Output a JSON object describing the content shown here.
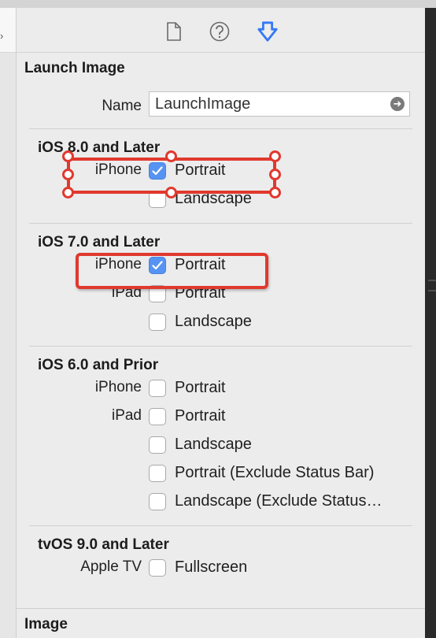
{
  "tabs": [
    {
      "icon": "file-icon"
    },
    {
      "icon": "help-icon"
    },
    {
      "icon": "attributes-icon",
      "selected": true
    }
  ],
  "accent": "#3478f6",
  "annotation_color": "#e0392e",
  "section_title": "Launch Image",
  "name_field": {
    "label": "Name",
    "value": "LaunchImage"
  },
  "groups": [
    {
      "header": "iOS 8.0 and Later",
      "rows": [
        {
          "label": "iPhone",
          "option": "Portrait",
          "checked": true
        },
        {
          "label": "",
          "option": "Landscape",
          "checked": false
        }
      ]
    },
    {
      "header": "iOS 7.0 and Later",
      "rows": [
        {
          "label": "iPhone",
          "option": "Portrait",
          "checked": true
        },
        {
          "label": "iPad",
          "option": "Portrait",
          "checked": false
        },
        {
          "label": "",
          "option": "Landscape",
          "checked": false
        }
      ]
    },
    {
      "header": "iOS 6.0 and Prior",
      "rows": [
        {
          "label": "iPhone",
          "option": "Portrait",
          "checked": false
        },
        {
          "label": "iPad",
          "option": "Portrait",
          "checked": false
        },
        {
          "label": "",
          "option": "Landscape",
          "checked": false
        },
        {
          "label": "",
          "option": "Portrait (Exclude Status Bar)",
          "checked": false
        },
        {
          "label": "",
          "option": "Landscape (Exclude Status…",
          "checked": false
        }
      ]
    },
    {
      "header": "tvOS 9.0 and Later",
      "rows": [
        {
          "label": "Apple TV",
          "option": "Fullscreen",
          "checked": false
        }
      ]
    }
  ],
  "next_section_title": "Image"
}
